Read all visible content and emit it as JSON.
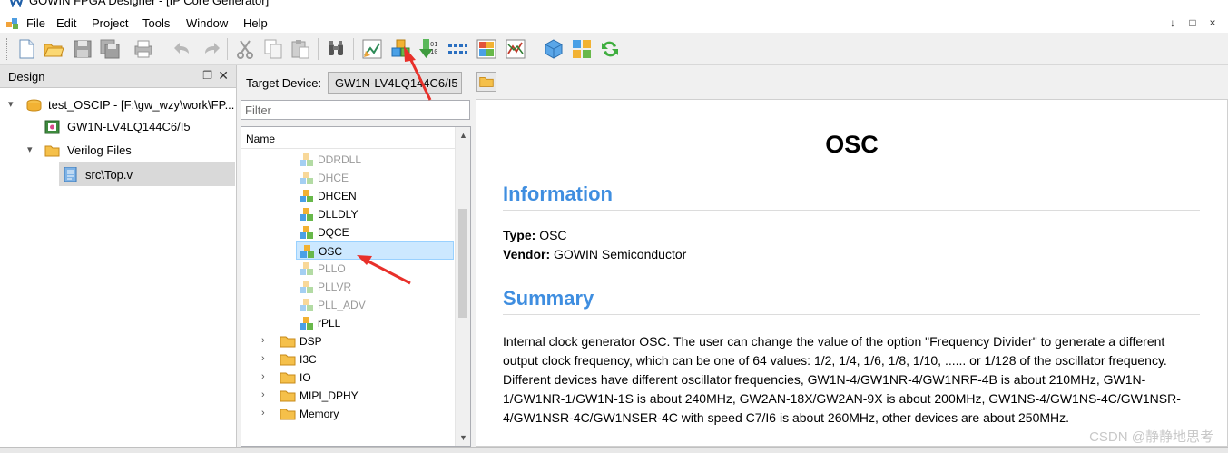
{
  "window": {
    "title": "GOWIN FPGA Designer - [IP Core Generator]"
  },
  "menu": {
    "items": [
      "File",
      "Edit",
      "Project",
      "Tools",
      "Window",
      "Help"
    ],
    "mdi_controls": [
      "↓",
      "□",
      "×"
    ]
  },
  "toolbar": {
    "buttons": [
      "new-file",
      "open-file",
      "save",
      "save-all",
      "print",
      "undo",
      "redo",
      "cut",
      "copy",
      "paste",
      "find",
      "synthesize",
      "ip-core-generator",
      "place-route",
      "program-device",
      "floorplanner",
      "timing-constraints",
      "gowin-analyzer",
      "ip-package",
      "hierarchy",
      "refresh"
    ]
  },
  "design_panel": {
    "title": "Design",
    "float_icon": "❐",
    "close_icon": "✕",
    "tree": [
      {
        "label": "test_OSCIP - [F:\\gw_wzy\\work\\FP...",
        "icon": "project-icon",
        "expanded": true
      },
      {
        "label": "GW1N-LV4LQ144C6/I5",
        "icon": "chip-icon"
      },
      {
        "label": "Verilog Files",
        "icon": "folder-icon",
        "expanded": true
      },
      {
        "label": "src\\Top.v",
        "icon": "verilog-file-icon",
        "selected": true
      }
    ]
  },
  "ip_panel": {
    "target_label": "Target Device:",
    "target_value": "GW1N-LV4LQ144C6/I5",
    "filter_placeholder": "Filter",
    "list_header": "Name",
    "items": [
      {
        "label": "DDRDLL",
        "disabled": true
      },
      {
        "label": "DHCE",
        "disabled": true
      },
      {
        "label": "DHCEN",
        "disabled": false
      },
      {
        "label": "DLLDLY",
        "disabled": false
      },
      {
        "label": "DQCE",
        "disabled": false
      },
      {
        "label": "OSC",
        "disabled": false,
        "selected": true
      },
      {
        "label": "PLLO",
        "disabled": true
      },
      {
        "label": "PLLVR",
        "disabled": true
      },
      {
        "label": "PLL_ADV",
        "disabled": true
      },
      {
        "label": "rPLL",
        "disabled": false
      }
    ],
    "categories": [
      "DSP",
      "I3C",
      "IO",
      "MIPI_DPHY",
      "Memory"
    ]
  },
  "doc": {
    "title": "OSC",
    "information_heading": "Information",
    "type_key": "Type:",
    "type_value": "OSC",
    "vendor_key": "Vendor:",
    "vendor_value": "GOWIN Semiconductor",
    "summary_heading": "Summary",
    "summary_text": "Internal clock generator OSC. The user can change the value of the option \"Frequency Divider\" to generate a different output clock frequency, which can be one of 64 values: 1/2, 1/4, 1/6, 1/8, 1/10, ...... or 1/128 of the oscillator frequency. Different devices have different oscillator frequencies, GW1N-4/GW1NR-4/GW1NRF-4B is about 210MHz, GW1N-1/GW1NR-1/GW1N-1S is about 240MHz, GW2AN-18X/GW2AN-9X is about 200MHz, GW1NS-4/GW1NS-4C/GW1NSR-4/GW1NSR-4C/GW1NSER-4C with speed C7/I6 is about 260MHz, other devices are about 250MHz."
  },
  "watermark": "CSDN @静静地思考",
  "colors": {
    "heading_blue": "#3f8ee0",
    "selection_blue": "#cce8ff",
    "annotation_red": "#e8302a"
  }
}
